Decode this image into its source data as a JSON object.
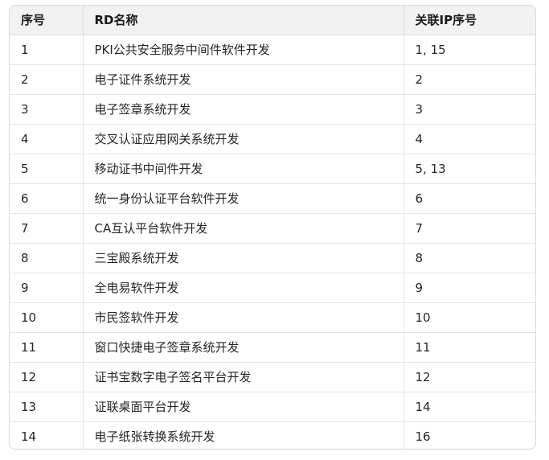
{
  "table": {
    "headers": [
      "序号",
      "RD名称",
      "关联IP序号"
    ],
    "rows": [
      [
        "1",
        "PKI公共安全服务中间件软件开发",
        "1, 15"
      ],
      [
        "2",
        "电子证件系统开发",
        "2"
      ],
      [
        "3",
        "电子签章系统开发",
        "3"
      ],
      [
        "4",
        "交叉认证应用网关系统开发",
        "4"
      ],
      [
        "5",
        "移动证书中间件开发",
        "5, 13"
      ],
      [
        "6",
        "统一身份认证平台软件开发",
        "6"
      ],
      [
        "7",
        "CA互认平台软件开发",
        "7"
      ],
      [
        "8",
        "三宝殿系统开发",
        "8"
      ],
      [
        "9",
        "全电易软件开发",
        "9"
      ],
      [
        "10",
        "市民签软件开发",
        "10"
      ],
      [
        "11",
        "窗口快捷电子签章系统开发",
        "11"
      ],
      [
        "12",
        "证书宝数字电子签名平台开发",
        "12"
      ],
      [
        "13",
        "证联桌面平台开发",
        "14"
      ],
      [
        "14",
        "电子纸张转换系统开发",
        "16"
      ]
    ]
  }
}
